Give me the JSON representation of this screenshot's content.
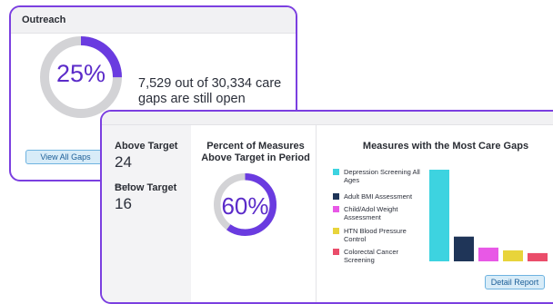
{
  "outreach": {
    "title": "Outreach",
    "percent_label": "25%",
    "percent_value": 0.25,
    "gap_text": "7,529 out of 30,334 care gaps are still open",
    "view_button": "View All Gaps"
  },
  "performance": {
    "above_label": "Above Target",
    "above_value": "24",
    "below_label": "Below Target",
    "below_value": "16",
    "percent_title": "Percent of Measures Above Target in Period",
    "percent_label": "60%",
    "percent_value": 0.6,
    "chart_title": "Measures with the Most Care Gaps",
    "detail_button": "Detail Report"
  },
  "colors": {
    "accent": "#7b3fe0",
    "donut_fill": "#6a3be0",
    "donut_track": "#d3d3d6",
    "button_bg": "#d8ecf8"
  },
  "chart_data": {
    "type": "bar",
    "categories": [
      "Depression Screening All Ages",
      "Adult BMI Assessment",
      "Child/Adol Weight Assessment",
      "HTN Blood Pressure Control",
      "Colorectal Cancer Screening"
    ],
    "values": [
      100,
      27,
      15,
      12,
      9
    ],
    "colors": [
      "#3dd3e0",
      "#1f3558",
      "#e858e6",
      "#e8d43b",
      "#ea4d6a"
    ],
    "legend_position": "left",
    "grid": false
  }
}
